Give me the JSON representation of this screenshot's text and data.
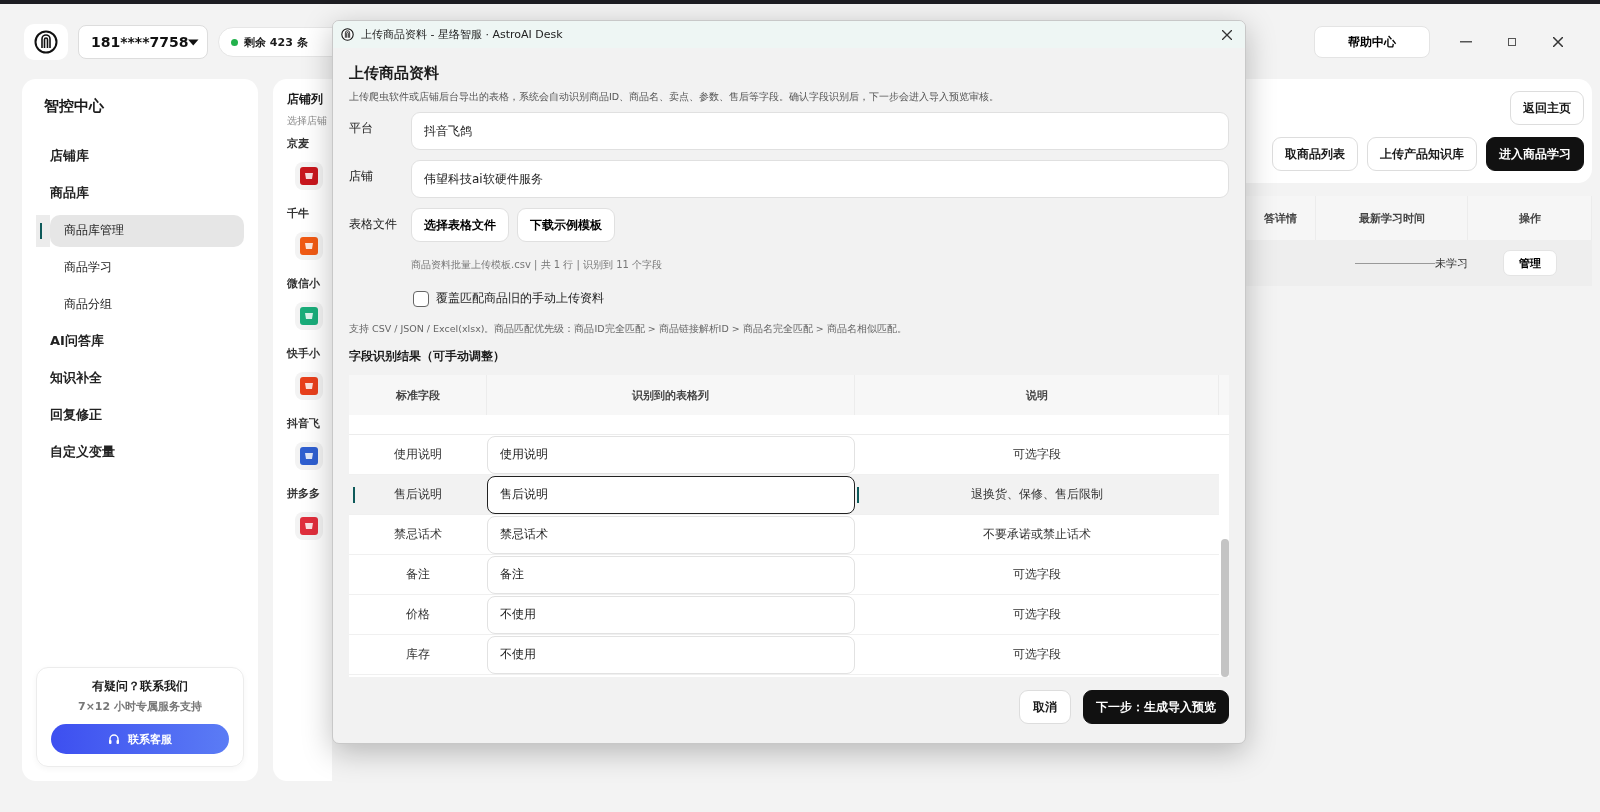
{
  "header": {
    "phone": "181****7758",
    "quota": "剩余 423 条",
    "quota_online": true,
    "help": "帮助中心"
  },
  "sidebar": {
    "title": "智控中心",
    "items": [
      {
        "label": "店铺库",
        "selected": false
      },
      {
        "label": "商品库",
        "selected": false,
        "children": [
          {
            "label": "商品库管理",
            "selected": true
          },
          {
            "label": "商品学习",
            "selected": false
          },
          {
            "label": "商品分组",
            "selected": false
          }
        ]
      },
      {
        "label": "AI问答库",
        "selected": false
      },
      {
        "label": "知识补全",
        "selected": false
      },
      {
        "label": "回复修正",
        "selected": false
      },
      {
        "label": "自定义变量",
        "selected": false
      }
    ],
    "support": {
      "title": "有疑问？联系我们",
      "subtitle": "7×12 小时专属服务支持",
      "button": "联系客服"
    }
  },
  "store_panel": {
    "title": "店铺列",
    "hint": "选择店铺",
    "groups": [
      {
        "name": "京麦",
        "color": "#c8161d"
      },
      {
        "name": "千牛",
        "color": "#f05a14"
      },
      {
        "name": "微信小",
        "color": "#1aad7a"
      },
      {
        "name": "快手小",
        "color": "#e8401c"
      },
      {
        "name": "抖音飞",
        "color": "#2f5fd0"
      },
      {
        "name": "拼多多",
        "color": "#e02e3c"
      }
    ]
  },
  "content": {
    "home_button": "返回主页",
    "actions": [
      {
        "label": "取商品列表",
        "primary": false
      },
      {
        "label": "上传产品知识库",
        "primary": false
      },
      {
        "label": "进入商品学习",
        "primary": true
      }
    ],
    "table": {
      "columns": [
        "答详情",
        "最新学习时间",
        "操作"
      ],
      "rows": [
        {
          "time": "未学习",
          "action": "管理"
        }
      ]
    }
  },
  "modal": {
    "window_title": "上传商品资料 - 星络智服 · AstroAI Desk",
    "heading": "上传商品资料",
    "description": "上传爬虫软件或店铺后台导出的表格，系统会自动识别商品ID、商品名、卖点、参数、售后等字段。确认字段识别后，下一步会进入导入预览审核。",
    "platform_label": "平台",
    "platform": "抖音飞鸽",
    "store_label": "店铺",
    "store": "伟望科技ai软硬件服务",
    "file_label": "表格文件",
    "file_buttons": [
      "选择表格文件",
      "下载示例模板"
    ],
    "file_info": "商品资料批量上传模板.csv | 共 1 行 | 识别到 11 个字段",
    "overwrite": {
      "label": "覆盖匹配商品旧的手动上传资料",
      "checked": false
    },
    "support_note": "支持 CSV / JSON / Excel(xlsx)。商品匹配优先级：商品ID完全匹配 > 商品链接解析ID > 商品名完全匹配 > 商品名相似匹配。",
    "section_title": "字段识别结果（可手动调整）",
    "table": {
      "columns": [
        "标准字段",
        "识别到的表格列",
        "说明"
      ],
      "rows": [
        {
          "field": "使用说明",
          "column": "使用说明",
          "note": "可选字段",
          "selected": false
        },
        {
          "field": "售后说明",
          "column": "售后说明",
          "note": "退换货、保修、售后限制",
          "selected": true
        },
        {
          "field": "禁忌话术",
          "column": "禁忌话术",
          "note": "不要承诺或禁止话术",
          "selected": false
        },
        {
          "field": "备注",
          "column": "备注",
          "note": "可选字段",
          "selected": false
        },
        {
          "field": "价格",
          "column": "不使用",
          "note": "可选字段",
          "selected": false
        },
        {
          "field": "库存",
          "column": "不使用",
          "note": "可选字段",
          "selected": false
        }
      ]
    },
    "cancel": "取消",
    "next": "下一步：生成导入预览"
  }
}
